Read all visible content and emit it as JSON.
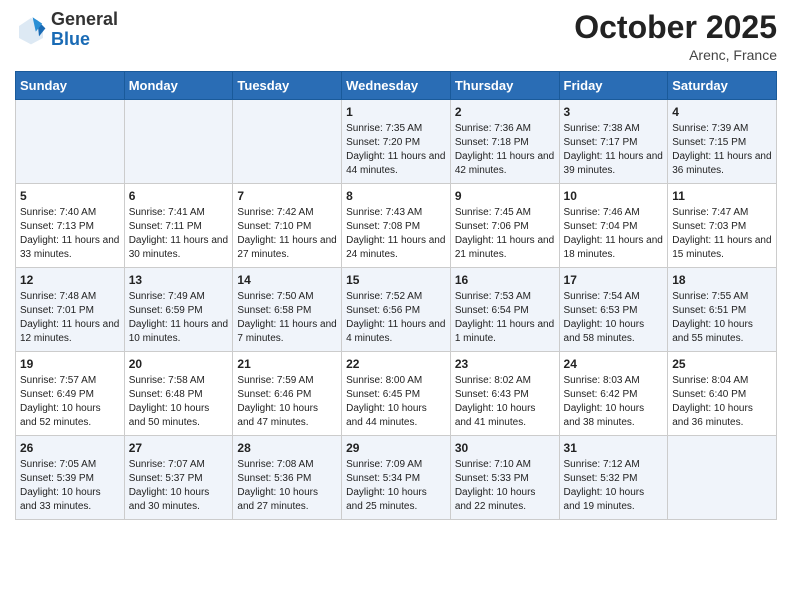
{
  "header": {
    "logo_general": "General",
    "logo_blue": "Blue",
    "month_title": "October 2025",
    "location": "Arenc, France"
  },
  "days_of_week": [
    "Sunday",
    "Monday",
    "Tuesday",
    "Wednesday",
    "Thursday",
    "Friday",
    "Saturday"
  ],
  "weeks": [
    [
      {
        "day": "",
        "info": ""
      },
      {
        "day": "",
        "info": ""
      },
      {
        "day": "",
        "info": ""
      },
      {
        "day": "1",
        "info": "Sunrise: 7:35 AM\nSunset: 7:20 PM\nDaylight: 11 hours and 44 minutes."
      },
      {
        "day": "2",
        "info": "Sunrise: 7:36 AM\nSunset: 7:18 PM\nDaylight: 11 hours and 42 minutes."
      },
      {
        "day": "3",
        "info": "Sunrise: 7:38 AM\nSunset: 7:17 PM\nDaylight: 11 hours and 39 minutes."
      },
      {
        "day": "4",
        "info": "Sunrise: 7:39 AM\nSunset: 7:15 PM\nDaylight: 11 hours and 36 minutes."
      }
    ],
    [
      {
        "day": "5",
        "info": "Sunrise: 7:40 AM\nSunset: 7:13 PM\nDaylight: 11 hours and 33 minutes."
      },
      {
        "day": "6",
        "info": "Sunrise: 7:41 AM\nSunset: 7:11 PM\nDaylight: 11 hours and 30 minutes."
      },
      {
        "day": "7",
        "info": "Sunrise: 7:42 AM\nSunset: 7:10 PM\nDaylight: 11 hours and 27 minutes."
      },
      {
        "day": "8",
        "info": "Sunrise: 7:43 AM\nSunset: 7:08 PM\nDaylight: 11 hours and 24 minutes."
      },
      {
        "day": "9",
        "info": "Sunrise: 7:45 AM\nSunset: 7:06 PM\nDaylight: 11 hours and 21 minutes."
      },
      {
        "day": "10",
        "info": "Sunrise: 7:46 AM\nSunset: 7:04 PM\nDaylight: 11 hours and 18 minutes."
      },
      {
        "day": "11",
        "info": "Sunrise: 7:47 AM\nSunset: 7:03 PM\nDaylight: 11 hours and 15 minutes."
      }
    ],
    [
      {
        "day": "12",
        "info": "Sunrise: 7:48 AM\nSunset: 7:01 PM\nDaylight: 11 hours and 12 minutes."
      },
      {
        "day": "13",
        "info": "Sunrise: 7:49 AM\nSunset: 6:59 PM\nDaylight: 11 hours and 10 minutes."
      },
      {
        "day": "14",
        "info": "Sunrise: 7:50 AM\nSunset: 6:58 PM\nDaylight: 11 hours and 7 minutes."
      },
      {
        "day": "15",
        "info": "Sunrise: 7:52 AM\nSunset: 6:56 PM\nDaylight: 11 hours and 4 minutes."
      },
      {
        "day": "16",
        "info": "Sunrise: 7:53 AM\nSunset: 6:54 PM\nDaylight: 11 hours and 1 minute."
      },
      {
        "day": "17",
        "info": "Sunrise: 7:54 AM\nSunset: 6:53 PM\nDaylight: 10 hours and 58 minutes."
      },
      {
        "day": "18",
        "info": "Sunrise: 7:55 AM\nSunset: 6:51 PM\nDaylight: 10 hours and 55 minutes."
      }
    ],
    [
      {
        "day": "19",
        "info": "Sunrise: 7:57 AM\nSunset: 6:49 PM\nDaylight: 10 hours and 52 minutes."
      },
      {
        "day": "20",
        "info": "Sunrise: 7:58 AM\nSunset: 6:48 PM\nDaylight: 10 hours and 50 minutes."
      },
      {
        "day": "21",
        "info": "Sunrise: 7:59 AM\nSunset: 6:46 PM\nDaylight: 10 hours and 47 minutes."
      },
      {
        "day": "22",
        "info": "Sunrise: 8:00 AM\nSunset: 6:45 PM\nDaylight: 10 hours and 44 minutes."
      },
      {
        "day": "23",
        "info": "Sunrise: 8:02 AM\nSunset: 6:43 PM\nDaylight: 10 hours and 41 minutes."
      },
      {
        "day": "24",
        "info": "Sunrise: 8:03 AM\nSunset: 6:42 PM\nDaylight: 10 hours and 38 minutes."
      },
      {
        "day": "25",
        "info": "Sunrise: 8:04 AM\nSunset: 6:40 PM\nDaylight: 10 hours and 36 minutes."
      }
    ],
    [
      {
        "day": "26",
        "info": "Sunrise: 7:05 AM\nSunset: 5:39 PM\nDaylight: 10 hours and 33 minutes."
      },
      {
        "day": "27",
        "info": "Sunrise: 7:07 AM\nSunset: 5:37 PM\nDaylight: 10 hours and 30 minutes."
      },
      {
        "day": "28",
        "info": "Sunrise: 7:08 AM\nSunset: 5:36 PM\nDaylight: 10 hours and 27 minutes."
      },
      {
        "day": "29",
        "info": "Sunrise: 7:09 AM\nSunset: 5:34 PM\nDaylight: 10 hours and 25 minutes."
      },
      {
        "day": "30",
        "info": "Sunrise: 7:10 AM\nSunset: 5:33 PM\nDaylight: 10 hours and 22 minutes."
      },
      {
        "day": "31",
        "info": "Sunrise: 7:12 AM\nSunset: 5:32 PM\nDaylight: 10 hours and 19 minutes."
      },
      {
        "day": "",
        "info": ""
      }
    ]
  ]
}
